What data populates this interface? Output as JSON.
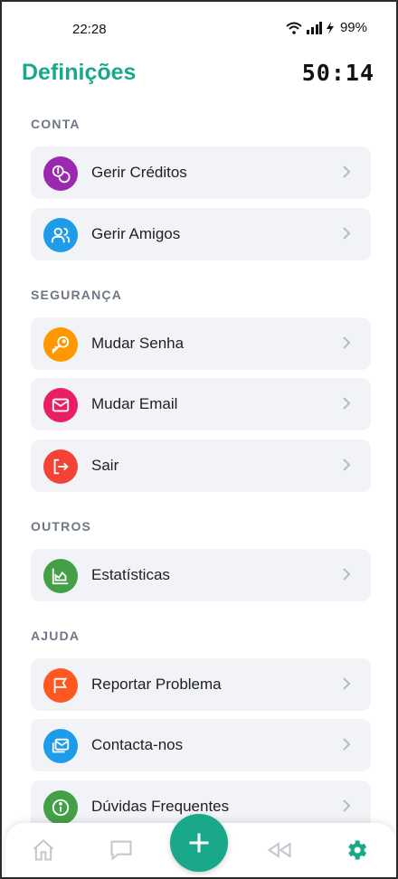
{
  "status_bar": {
    "time": "22:28",
    "battery": "99%"
  },
  "header": {
    "title": "Definições",
    "timer": "50:14"
  },
  "sections": {
    "conta": {
      "label": "CONTA",
      "items": [
        {
          "label": "Gerir Créditos",
          "icon": "coins-icon",
          "color": "#9c27b0"
        },
        {
          "label": "Gerir Amigos",
          "icon": "users-icon",
          "color": "#1e9be9"
        }
      ]
    },
    "seguranca": {
      "label": "SEGURANÇA",
      "items": [
        {
          "label": "Mudar Senha",
          "icon": "key-icon",
          "color": "#ff9800"
        },
        {
          "label": "Mudar Email",
          "icon": "mail-icon",
          "color": "#e91e63"
        },
        {
          "label": "Sair",
          "icon": "logout-icon",
          "color": "#f44336"
        }
      ]
    },
    "outros": {
      "label": "OUTROS",
      "items": [
        {
          "label": "Estatísticas",
          "icon": "chart-icon",
          "color": "#43a047"
        }
      ]
    },
    "ajuda": {
      "label": "AJUDA",
      "items": [
        {
          "label": "Reportar Problema",
          "icon": "flag-icon",
          "color": "#ff5722"
        },
        {
          "label": "Contacta-nos",
          "icon": "mail-stack-icon",
          "color": "#1e9be9"
        },
        {
          "label": "Dúvidas Frequentes",
          "icon": "info-icon",
          "color": "#43a047"
        }
      ]
    }
  },
  "bottom_nav": {
    "items": [
      "home-icon",
      "chat-icon",
      "add-icon",
      "rewind-icon",
      "gear-icon"
    ],
    "active": "gear-icon",
    "accent": "#1aa88a"
  }
}
